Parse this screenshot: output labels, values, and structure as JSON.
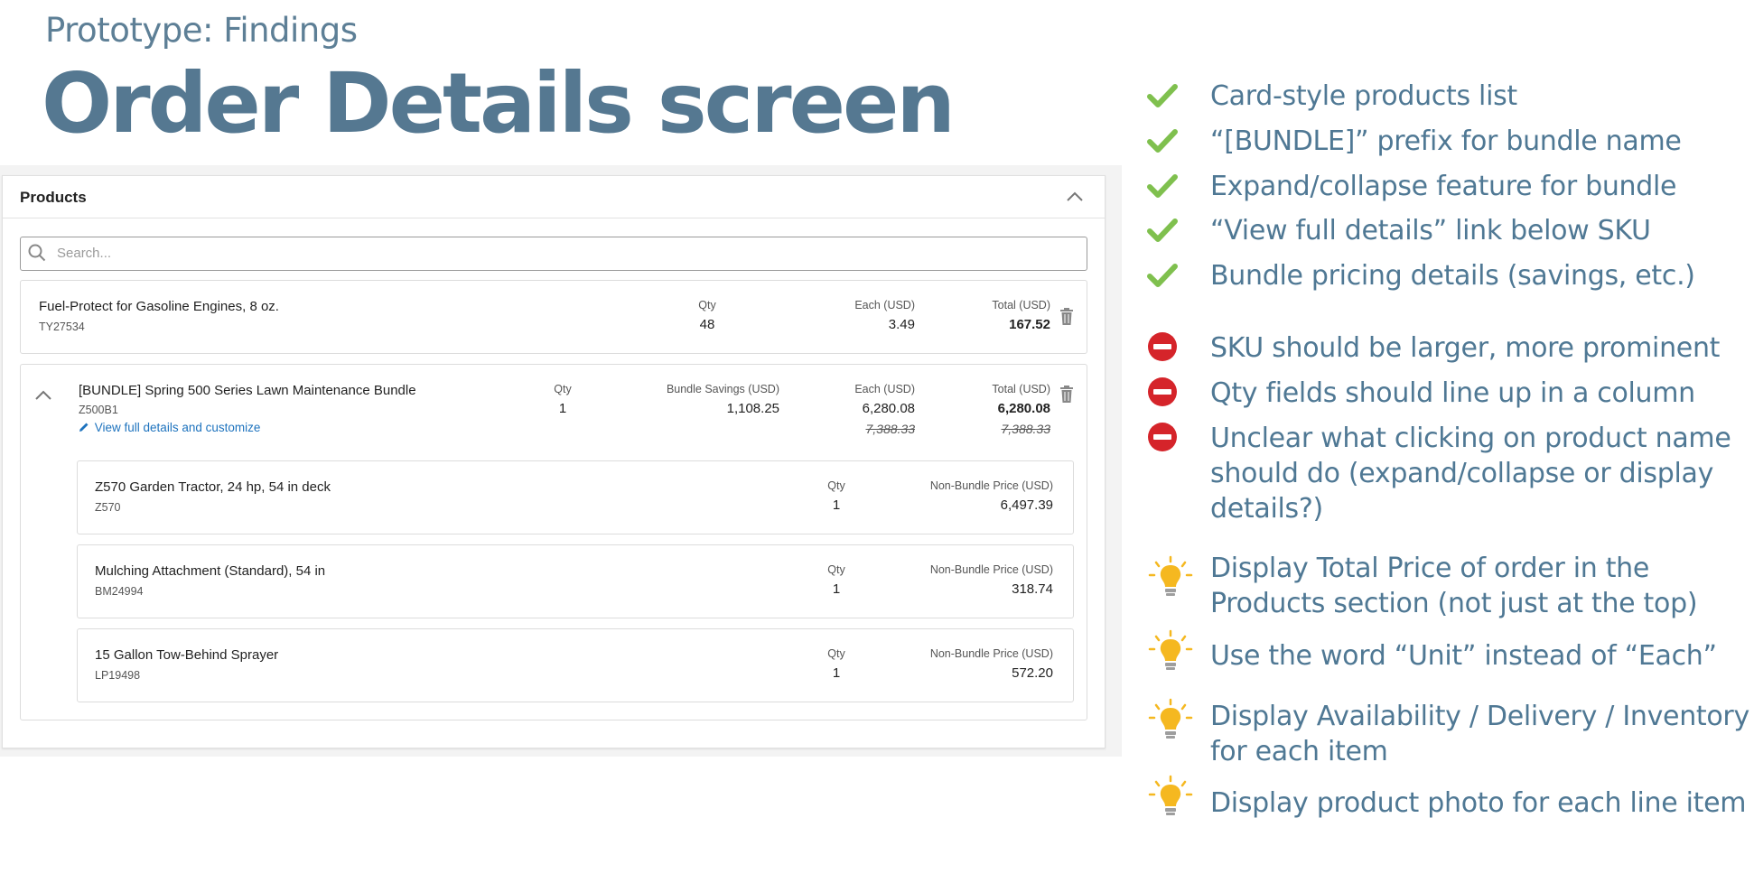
{
  "slide": {
    "subtitle": "Prototype: Findings",
    "title": "Order Details screen"
  },
  "products_panel": {
    "title": "Products",
    "search_placeholder": "Search...",
    "item1": {
      "name": "Fuel-Protect for Gasoline Engines, 8 oz.",
      "sku": "TY27534",
      "qty_label": "Qty",
      "qty": "48",
      "each_label": "Each (USD)",
      "each": "3.49",
      "total_label": "Total (USD)",
      "total": "167.52"
    },
    "bundle": {
      "name": "[BUNDLE] Spring 500 Series Lawn Maintenance Bundle",
      "sku": "Z500B1",
      "link": "View full details and customize",
      "qty_label": "Qty",
      "qty": "1",
      "savings_label": "Bundle Savings (USD)",
      "savings": "1,108.25",
      "each_label": "Each (USD)",
      "each": "6,280.08",
      "each_original": "7,388.33",
      "total_label": "Total (USD)",
      "total": "6,280.08",
      "total_original": "7,388.33",
      "components": [
        {
          "name": "Z570 Garden Tractor, 24 hp, 54 in deck",
          "sku": "Z570",
          "qty_label": "Qty",
          "qty": "1",
          "price_label": "Non-Bundle Price (USD)",
          "price": "6,497.39"
        },
        {
          "name": "Mulching Attachment (Standard), 54 in",
          "sku": "BM24994",
          "qty_label": "Qty",
          "qty": "1",
          "price_label": "Non-Bundle Price (USD)",
          "price": "318.74"
        },
        {
          "name": "15 Gallon Tow-Behind Sprayer",
          "sku": "LP19498",
          "qty_label": "Qty",
          "qty": "1",
          "price_label": "Non-Bundle Price (USD)",
          "price": "572.20"
        }
      ]
    }
  },
  "findings": {
    "positives": [
      "Card-style products list",
      "“[BUNDLE]” prefix for bundle name",
      "Expand/collapse feature for bundle",
      "“View full details” link below SKU",
      "Bundle pricing details (savings, etc.)"
    ],
    "issues": [
      "SKU should be larger, more prominent",
      "Qty fields should line up in a column",
      "Unclear what clicking on product name should do (expand/collapse or display details?)"
    ],
    "ideas": [
      "Display Total Price of order in the Products section (not just at the top)",
      "Use the word “Unit” instead of “Each”",
      "Display Availability / Delivery / Inventory for each item",
      "Display product photo for each line item"
    ]
  },
  "icons": {
    "positive": "checkmark-icon",
    "issue": "no-entry-icon",
    "idea": "lightbulb-icon"
  },
  "colors": {
    "heading": "#557891",
    "finding_text": "#4f7894",
    "check": "#7fc04e",
    "issue": "#d5242a",
    "idea": "#f5b820",
    "link": "#1e73be"
  }
}
